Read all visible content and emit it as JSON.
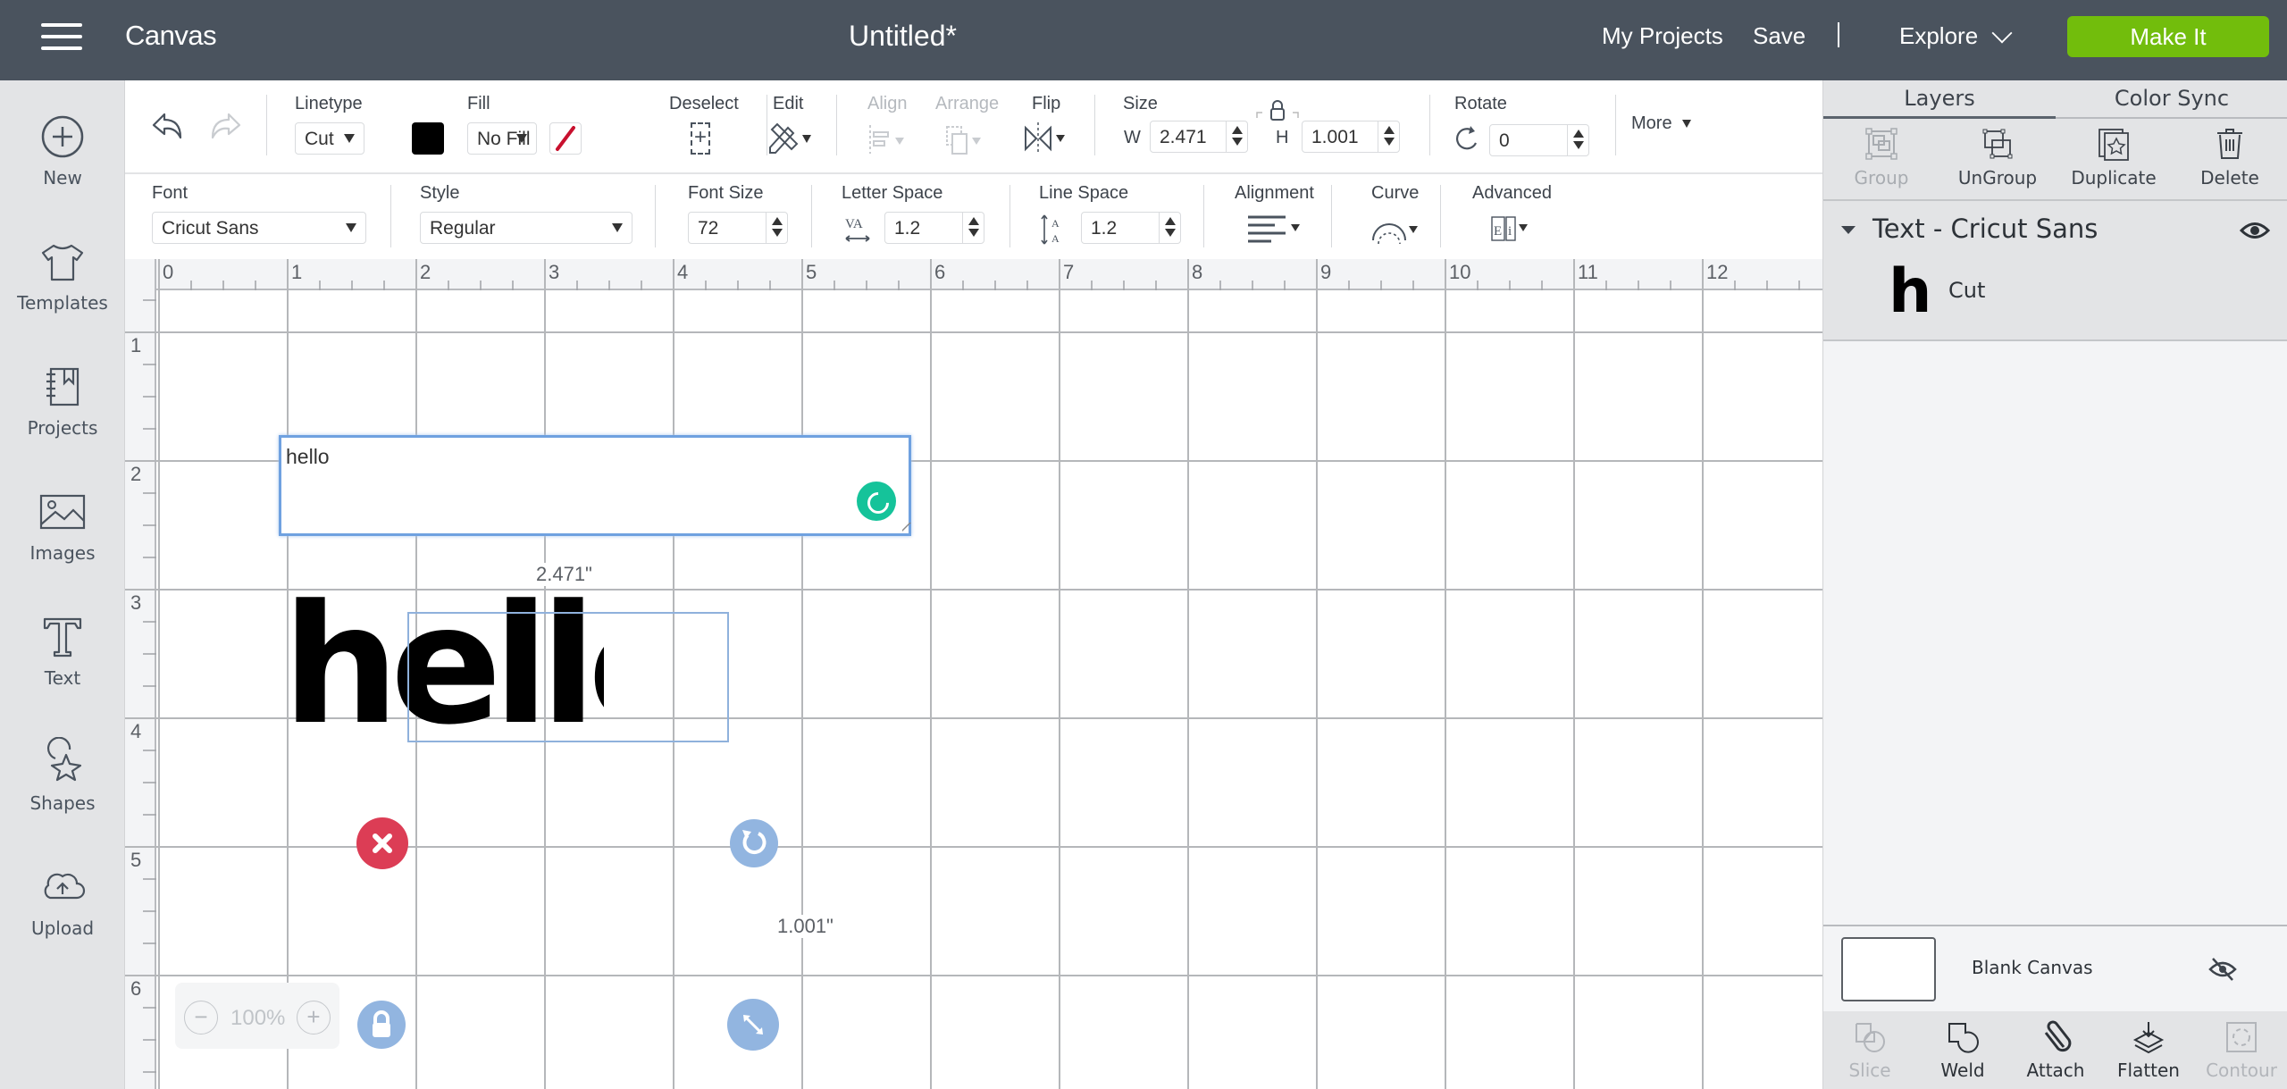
{
  "topbar": {
    "app_title": "Canvas",
    "doc_title": "Untitled*",
    "my_projects": "My Projects",
    "save": "Save",
    "explore": "Explore",
    "make_it": "Make It",
    "make_it_color": "#72bd0c"
  },
  "sidebar": {
    "items": [
      {
        "label": "New",
        "icon": "plus-circle-icon"
      },
      {
        "label": "Templates",
        "icon": "tshirt-icon"
      },
      {
        "label": "Projects",
        "icon": "notebook-icon"
      },
      {
        "label": "Images",
        "icon": "image-icon"
      },
      {
        "label": "Text",
        "icon": "text-t-icon"
      },
      {
        "label": "Shapes",
        "icon": "shapes-icon"
      },
      {
        "label": "Upload",
        "icon": "cloud-upload-icon"
      }
    ]
  },
  "toolbar": {
    "linetype_label": "Linetype",
    "linetype_value": "Cut",
    "linetype_color": "#000000",
    "fill_label": "Fill",
    "fill_value": "No Fill",
    "deselect_label": "Deselect",
    "edit_label": "Edit",
    "align_label": "Align",
    "arrange_label": "Arrange",
    "flip_label": "Flip",
    "size_label": "Size",
    "w_label": "W",
    "w_value": "2.471",
    "h_label": "H",
    "h_value": "1.001",
    "rotate_label": "Rotate",
    "rotate_value": "0",
    "more_label": "More"
  },
  "text_toolbar": {
    "font_label": "Font",
    "font_value": "Cricut Sans",
    "style_label": "Style",
    "style_value": "Regular",
    "font_size_label": "Font Size",
    "font_size_value": "72",
    "letter_space_label": "Letter Space",
    "letter_space_value": "1.2",
    "line_space_label": "Line Space",
    "line_space_value": "1.2",
    "alignment_label": "Alignment",
    "curve_label": "Curve",
    "advanced_label": "Advanced"
  },
  "canvas": {
    "ruler_x": [
      "0",
      "1",
      "2",
      "3",
      "4",
      "5",
      "6",
      "7",
      "8",
      "9",
      "10",
      "11",
      "12"
    ],
    "ruler_y": [
      "1",
      "2",
      "3",
      "4",
      "5",
      "6"
    ],
    "text_input_value": "hello",
    "rendered_text": "hello",
    "width_readout": "2.471\"",
    "height_readout": "1.001\"",
    "zoom_level": "100%",
    "zoom_minus": "−",
    "zoom_plus": "+"
  },
  "right_panel": {
    "tabs": [
      {
        "label": "Layers",
        "active": true
      },
      {
        "label": "Color Sync",
        "active": false
      }
    ],
    "actions": [
      {
        "label": "Group",
        "enabled": false
      },
      {
        "label": "UnGroup",
        "enabled": true
      },
      {
        "label": "Duplicate",
        "enabled": true
      },
      {
        "label": "Delete",
        "enabled": true
      }
    ],
    "layer_group_name": "Text - Cricut Sans",
    "layer_item_thumb": "h",
    "layer_item_name": "Cut",
    "blank_canvas_label": "Blank Canvas",
    "bottom_actions": [
      {
        "label": "Slice",
        "enabled": false
      },
      {
        "label": "Weld",
        "enabled": true
      },
      {
        "label": "Attach",
        "enabled": true
      },
      {
        "label": "Flatten",
        "enabled": true
      },
      {
        "label": "Contour",
        "enabled": false
      }
    ]
  }
}
